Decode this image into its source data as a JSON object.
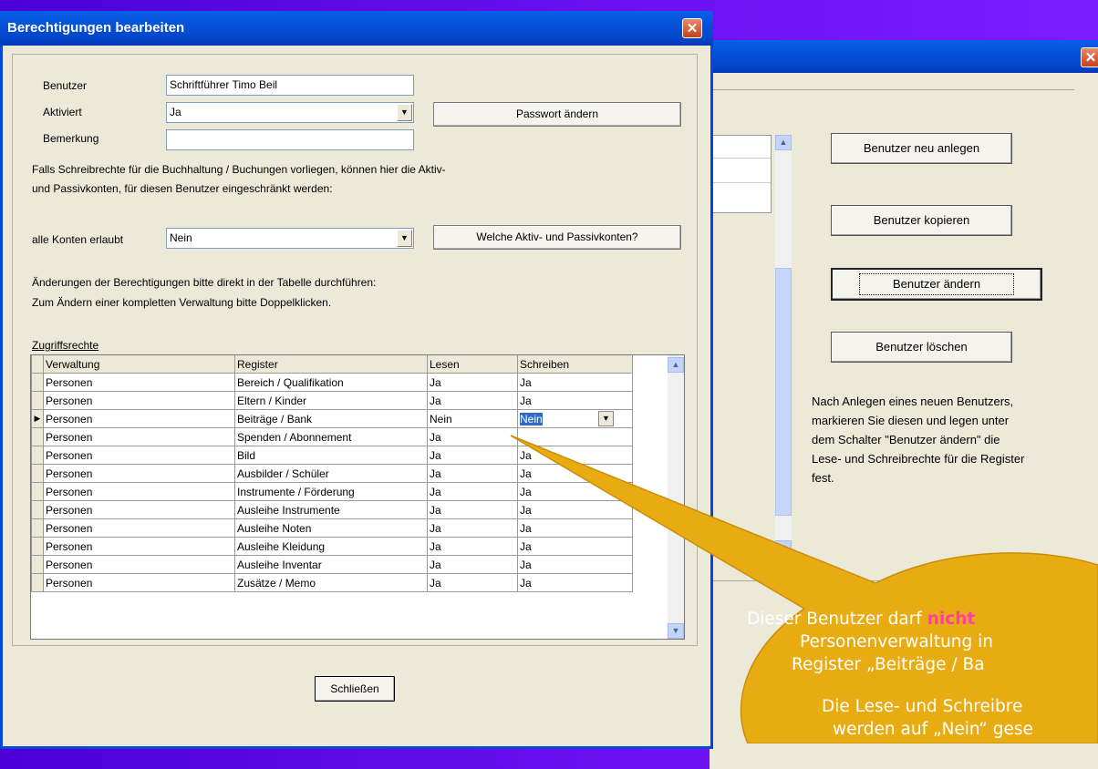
{
  "main_window": {
    "title": "Berechtigungen bearbeiten",
    "close_glyph": "✕",
    "fields": {
      "benutzer_label": "Benutzer",
      "benutzer_value": "Schriftführer Timo Beil",
      "aktiviert_label": "Aktiviert",
      "aktiviert_value": "Ja",
      "bemerkung_label": "Bemerkung",
      "bemerkung_value": ""
    },
    "passwort_button": "Passwort ändern",
    "info_line1": "Falls Schreibrechte für die Buchhaltung / Buchungen vorliegen, können hier die Aktiv-",
    "info_line2": "und Passivkonten, für diesen Benutzer eingeschränkt werden:",
    "alle_konten_label": "alle Konten erlaubt",
    "alle_konten_value": "Nein",
    "welche_konten_button": "Welche Aktiv- und Passivkonten?",
    "hint_line1": "Änderungen der Berechtigungen bitte direkt in der Tabelle durchführen:",
    "hint_line2": "Zum Ändern einer kompletten Verwaltung bitte Doppelklicken.",
    "grid_caption": "Zugriffsrechte",
    "grid": {
      "columns": [
        "Verwaltung",
        "Register",
        "Lesen",
        "Schreiben"
      ],
      "rows": [
        [
          "Personen",
          "Bereich / Qualifikation",
          "Ja",
          "Ja"
        ],
        [
          "Personen",
          "Eltern / Kinder",
          "Ja",
          "Ja"
        ],
        [
          "Personen",
          "Beiträge / Bank",
          "Nein",
          "Nein"
        ],
        [
          "Personen",
          "Spenden / Abonnement",
          "Ja",
          ""
        ],
        [
          "Personen",
          "Bild",
          "Ja",
          "Ja"
        ],
        [
          "Personen",
          "Ausbilder / Schüler",
          "Ja",
          "Ja"
        ],
        [
          "Personen",
          "Instrumente / Förderung",
          "Ja",
          "Ja"
        ],
        [
          "Personen",
          "Ausleihe Instrumente",
          "Ja",
          "Ja"
        ],
        [
          "Personen",
          "Ausleihe Noten",
          "Ja",
          "Ja"
        ],
        [
          "Personen",
          "Ausleihe Kleidung",
          "Ja",
          "Ja"
        ],
        [
          "Personen",
          "Ausleihe Inventar",
          "Ja",
          "Ja"
        ],
        [
          "Personen",
          "Zusätze / Memo",
          "Ja",
          "Ja"
        ]
      ],
      "selected_row": 2
    },
    "close_button": "Schließen"
  },
  "back_window": {
    "buttons": {
      "neu": "Benutzer neu anlegen",
      "kopieren": "Benutzer kopieren",
      "aendern": "Benutzer ändern",
      "loeschen": "Benutzer löschen"
    },
    "help_lines": [
      "Nach Anlegen eines neuen Benutzers,",
      "markieren Sie diesen und legen unter",
      "dem Schalter \"Benutzer ändern\" die",
      "Lese- und Schreibrechte für die Register",
      "fest."
    ]
  },
  "callout": {
    "line1_pre": "Dieser Benutzer darf ",
    "line1_emph": "nicht",
    "line2": "Personenverwaltung in",
    "line3": "Register „Beiträge / Ba",
    "line4": "Die Lese- und Schreibre",
    "line5": "werden auf „Nein“ gese"
  },
  "colors": {
    "desktop": "#5a0ae8",
    "titlebar": "#0453d9",
    "callout_fill": "#e8ac12",
    "callout_text": "#ffffff",
    "emphasis": "#ff3ea8",
    "selection": "#316ac5"
  }
}
